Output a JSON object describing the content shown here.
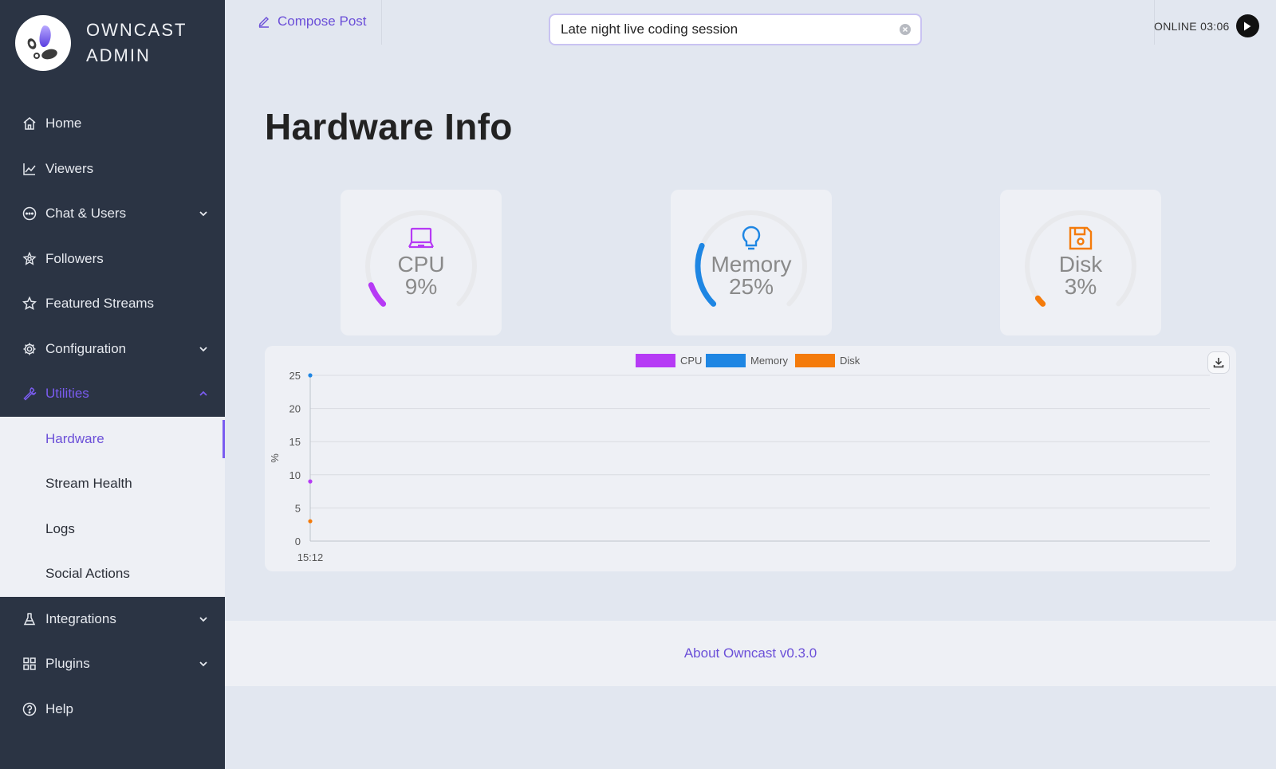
{
  "brand": {
    "line1": "OWNCAST",
    "line2": "ADMIN"
  },
  "sidebar": {
    "items": [
      {
        "label": "Home",
        "icon": "home-icon"
      },
      {
        "label": "Viewers",
        "icon": "line-chart-icon"
      },
      {
        "label": "Chat & Users",
        "icon": "message-icon",
        "expandable": true
      },
      {
        "label": "Followers",
        "icon": "followers-icon"
      },
      {
        "label": "Featured Streams",
        "icon": "star-icon"
      },
      {
        "label": "Configuration",
        "icon": "gear-icon",
        "expandable": true
      },
      {
        "label": "Utilities",
        "icon": "wrench-icon",
        "expanded": true
      },
      {
        "label": "Integrations",
        "icon": "flask-icon",
        "expandable": true
      },
      {
        "label": "Plugins",
        "icon": "grid-icon",
        "expandable": true
      },
      {
        "label": "Help",
        "icon": "question-icon"
      }
    ],
    "utilities_sub": [
      {
        "label": "Hardware",
        "active": true
      },
      {
        "label": "Stream Health"
      },
      {
        "label": "Logs"
      },
      {
        "label": "Social Actions"
      }
    ]
  },
  "topbar": {
    "compose_label": "Compose Post",
    "stream_title": "Late night live coding session",
    "status_text": "ONLINE 03:06"
  },
  "page": {
    "title": "Hardware Info"
  },
  "gauges": [
    {
      "name": "CPU",
      "value_label": "9%",
      "percent": 9,
      "color": "#b63af5",
      "icon": "laptop-icon"
    },
    {
      "name": "Memory",
      "value_label": "25%",
      "percent": 25,
      "color": "#1e86e3",
      "icon": "lightbulb-icon"
    },
    {
      "name": "Disk",
      "value_label": "3%",
      "percent": 3,
      "color": "#f47b0b",
      "icon": "floppy-disk-icon"
    }
  ],
  "chart_data": {
    "type": "line",
    "x": [
      "15:12"
    ],
    "series": [
      {
        "name": "CPU",
        "values": [
          9
        ],
        "color": "#b63af5"
      },
      {
        "name": "Memory",
        "values": [
          25
        ],
        "color": "#1e86e3"
      },
      {
        "name": "Disk",
        "values": [
          3
        ],
        "color": "#f47b0b"
      }
    ],
    "ylabel": "%",
    "yticks": [
      0,
      5,
      10,
      15,
      20,
      25
    ],
    "ylim": [
      0,
      25
    ],
    "grid": true,
    "legend": "top-center"
  },
  "footer": {
    "link_label": "About Owncast v0.3.0"
  }
}
